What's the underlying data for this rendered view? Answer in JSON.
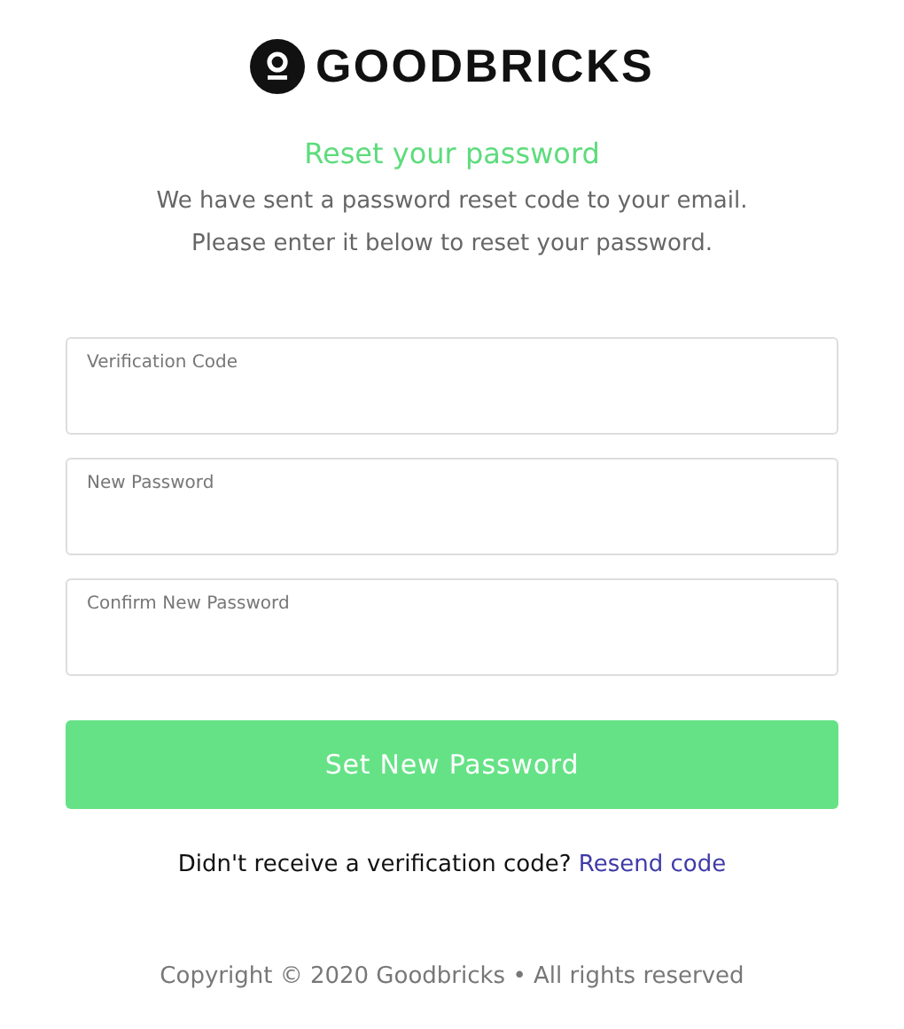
{
  "logo": {
    "text": "GOODBRICKS"
  },
  "title": "Reset your password",
  "description": [
    "We have sent a password reset code to your email.",
    "Please enter it below to reset your password."
  ],
  "fields": [
    {
      "label": "Verification Code"
    },
    {
      "label": "New Password"
    },
    {
      "label": "Confirm New Password"
    }
  ],
  "submit_button": "Set New Password",
  "resend": {
    "text": "Didn't receive a verification code?",
    "link": "Resend code"
  },
  "footer": "Copyright © 2020 Goodbricks • All rights reserved"
}
